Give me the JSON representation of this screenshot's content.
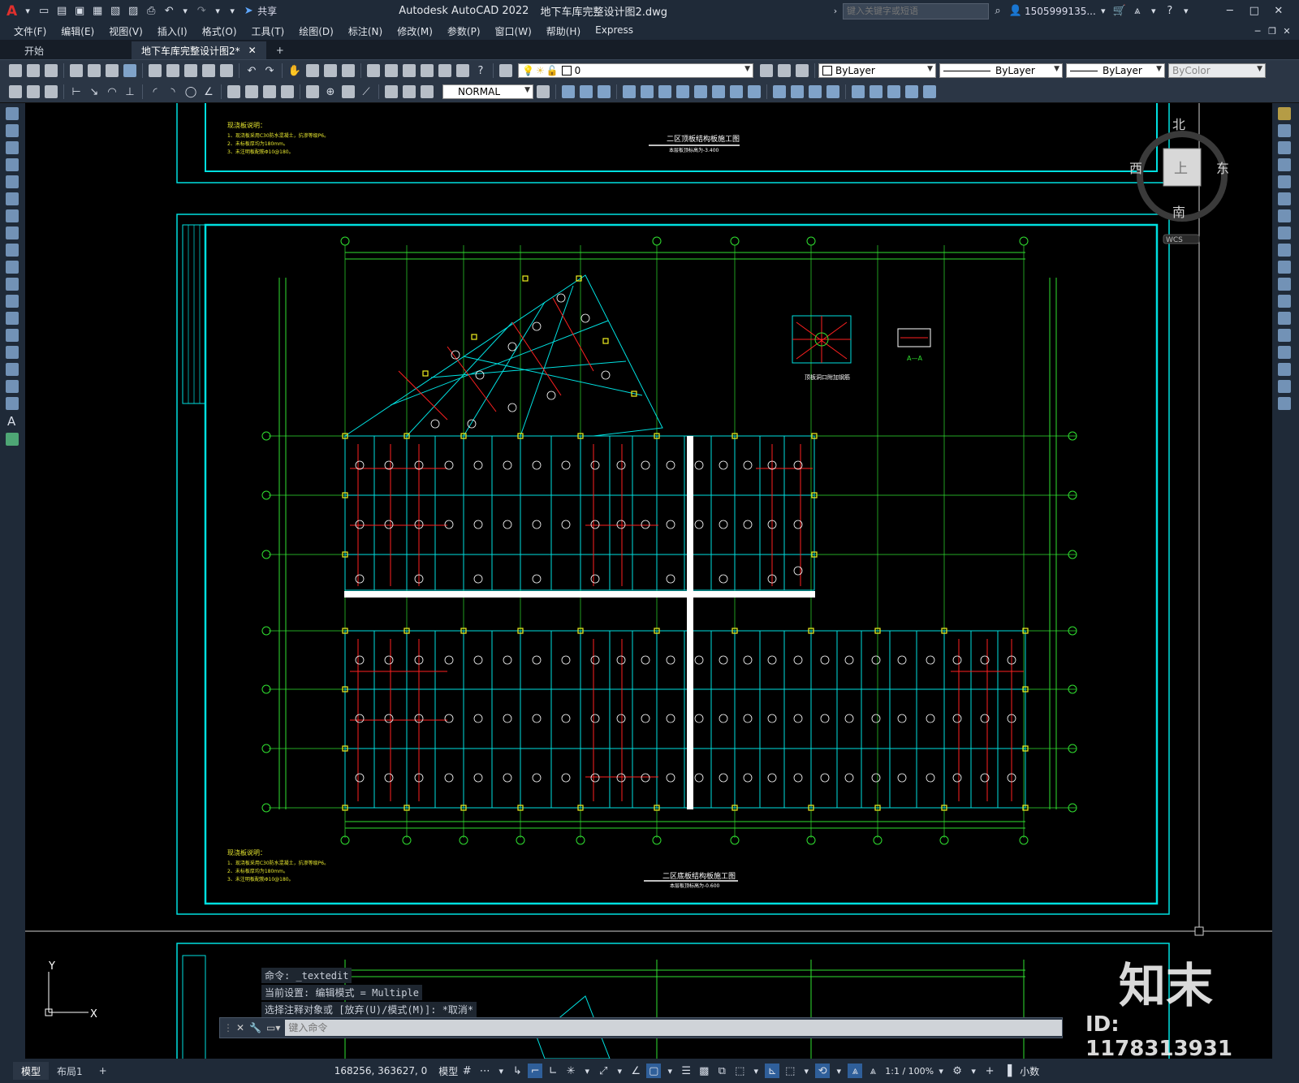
{
  "app": {
    "title": "Autodesk AutoCAD 2022",
    "document": "地下车库完整设计图2.dwg",
    "share_label": "共享",
    "search_placeholder": "键入关键字或短语",
    "user": "1505999135...",
    "logo": "A"
  },
  "menu": [
    "文件(F)",
    "编辑(E)",
    "视图(V)",
    "插入(I)",
    "格式(O)",
    "工具(T)",
    "绘图(D)",
    "标注(N)",
    "修改(M)",
    "参数(P)",
    "窗口(W)",
    "帮助(H)",
    "Express"
  ],
  "tabs": {
    "start": "开始",
    "active": "地下车库完整设计图2*",
    "add": "+"
  },
  "toolbar": {
    "layer_value": "0",
    "color": "ByLayer",
    "linetype": "ByLayer",
    "lineweight": "ByLayer",
    "plotstyle": "ByColor",
    "dimstyle": "NORMAL"
  },
  "viewcube": {
    "north": "北",
    "south": "南",
    "east": "东",
    "west": "西",
    "top": "上",
    "wcs": "WCS"
  },
  "drawing": {
    "notes_title_top": "现浇板说明：",
    "notes_top": [
      "1、现浇板采用C30防水混凝土，抗渗等级P6。",
      "2、未标板厚均为180mm。",
      "3、未注明板配筋Φ10@180。"
    ],
    "title_top": "二区顶板结构板施工图",
    "subtitle_top": "本层板顶标高为-3.400",
    "notes_title_main": "现浇板说明：",
    "notes_main": [
      "1、现浇板采用C30防水混凝土，抗渗等级P6。",
      "2、未标板厚均为180mm。",
      "3、未注明板配筋Φ10@180。"
    ],
    "title_main": "二区底板结构板施工图",
    "subtitle_main": "本层板顶标高为-0.600",
    "detail_title": "顶板洞口附加钢筋",
    "section_label": "A—A"
  },
  "command": {
    "history": [
      "命令: _textedit",
      "当前设置: 编辑模式 = Multiple",
      "选择注释对象或 [放弃(U)/模式(M)]: *取消*"
    ],
    "placeholder": "键入命令"
  },
  "layout_tabs": {
    "model": "模型",
    "layout1": "布局1",
    "add": "+"
  },
  "status": {
    "coords": "168256, 363627, 0",
    "space": "模型",
    "scale": "1:1 / 100%",
    "units": "小数"
  },
  "watermark": {
    "brand": "知末",
    "id": "ID: 1178313931"
  }
}
